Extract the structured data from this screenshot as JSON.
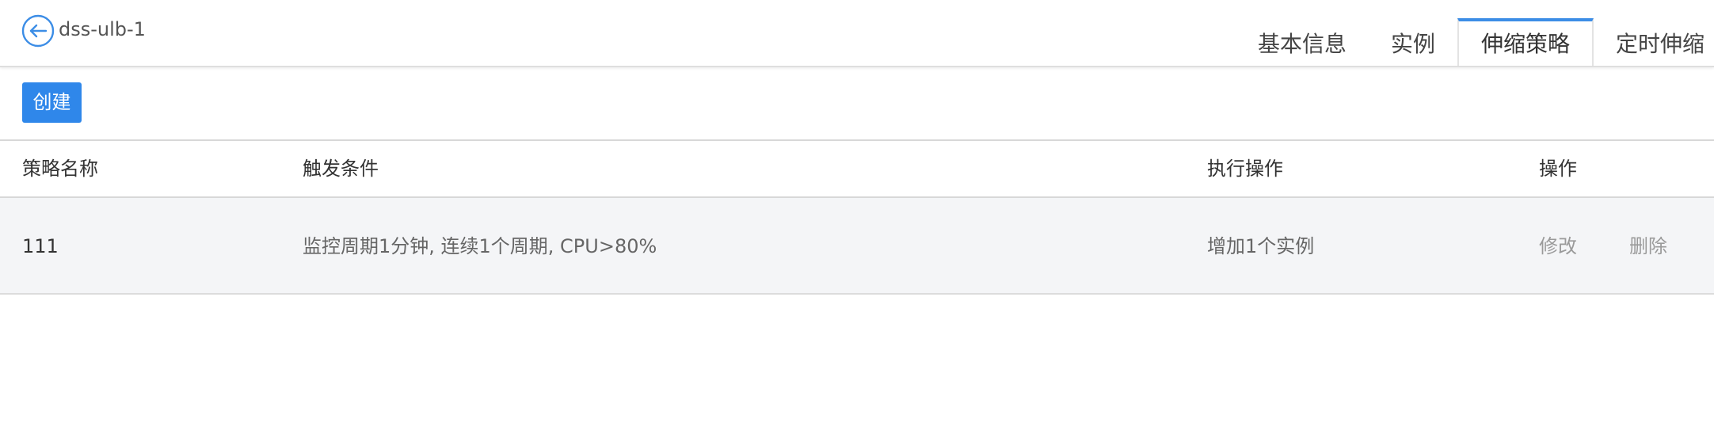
{
  "header": {
    "title": "dss-ulb-1",
    "tabs": [
      {
        "label": "基本信息",
        "active": false
      },
      {
        "label": "实例",
        "active": false
      },
      {
        "label": "伸缩策略",
        "active": true
      },
      {
        "label": "定时伸缩",
        "active": false
      }
    ]
  },
  "toolbar": {
    "create_label": "创建"
  },
  "table": {
    "columns": [
      "策略名称",
      "触发条件",
      "执行操作",
      "操作"
    ],
    "rows": [
      {
        "name": "111",
        "trigger": "监控周期1分钟, 连续1个周期, CPU>80%",
        "action": "增加1个实例",
        "edit_label": "修改",
        "delete_label": "删除"
      }
    ]
  },
  "colors": {
    "accent": "#2f87ea",
    "row_bg": "#f4f5f7",
    "link_muted": "#9a9a9a"
  },
  "icons": {
    "back": "back-arrow-circle-icon"
  }
}
